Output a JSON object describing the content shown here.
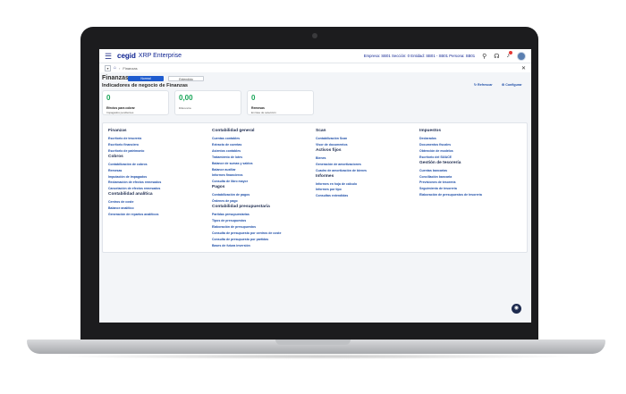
{
  "app": {
    "brand": "cegid",
    "product": "XRP Enterprise",
    "context": "Empresa: SB01 Sección: 0 Entidad: SB01 - SB01 Persona: SB01"
  },
  "breadcrumb": {
    "expand": "▾",
    "current": "Finanzas"
  },
  "header": {
    "title": "Finanzas",
    "toggle_normal": "Normal",
    "toggle_extended": "Extendido",
    "subtitle": "Indicadores de negocio de Finanzas",
    "refresh": "Refrescar",
    "configure": "Configurar"
  },
  "kpis": [
    {
      "value": "0",
      "label": "Efectos para cobrar",
      "sub": "Impagados pendientes"
    },
    {
      "value": "0,00",
      "label": "",
      "sub": "Diferencia"
    },
    {
      "value": "0",
      "label": "Remesas",
      "sub": "En fase de selección"
    }
  ],
  "menu": {
    "col1": {
      "g1": {
        "title": "Finanzas",
        "items": [
          "Escritorio de tesorería",
          "Escritorio financiero",
          "Escritorio de patrimonio"
        ]
      },
      "g2": {
        "title": "Cobros",
        "items": [
          "Contabilización de cobros",
          "Remesas",
          "Imputación de impagados",
          "Reclamación de efectos remesados",
          "Cancelación de efectos remesados"
        ]
      },
      "g3": {
        "title": "Contabilidad analítica",
        "items": [
          "Centros de coste",
          "Balance analítico",
          "Generación de repartos analíticos"
        ]
      }
    },
    "col2": {
      "g1": {
        "title": "Contabilidad general",
        "items": [
          "Cuentas contables",
          "Extracto de cuentas",
          "Asientos contables",
          "Tratamiento de lotes",
          "Balance de sumas y saldos",
          "Balance auxiliar",
          "Informes financieros",
          "Consulta de libro mayor"
        ]
      },
      "g2": {
        "title": "Pagos",
        "items": [
          "Contabilización de pagos",
          "Órdenes de pago"
        ]
      },
      "g3": {
        "title": "Contabilidad presupuestaria",
        "items": [
          "Partidas presupuestarias",
          "Tipos de presupuestos",
          "Elaboración de presupuestos",
          "Consulta de presupuesto por centros de coste",
          "Consulta de presupuesto por partidas",
          "Bases de futura inversión"
        ]
      }
    },
    "col3": {
      "g1": {
        "title": "Scan",
        "items": [
          "Contabilización Scan",
          "Visor de documentos"
        ]
      },
      "g2": {
        "title": "Activos fijos",
        "items": [
          "Bienes",
          "Generación de amortizaciones",
          "Cuadro de amortización de bienes"
        ]
      },
      "g3": {
        "title": "Informes",
        "items": [
          "Informes en hoja de cálculo",
          "Informes por tipo",
          "Consultas extendidas"
        ]
      }
    },
    "col4": {
      "g1": {
        "title": "Impuestos",
        "items": [
          "Declarados",
          "Documentos fiscales",
          "Obtención de modelos",
          "Escritorio del SII/ACE"
        ]
      },
      "g2": {
        "title": "Gestión de tesorería",
        "items": [
          "Cuentas bancarias",
          "Conciliación bancaria",
          "Previsiones de tesorería",
          "Seguimiento de tesorería",
          "Elaboración de presupuestos de tesorería"
        ]
      }
    }
  }
}
